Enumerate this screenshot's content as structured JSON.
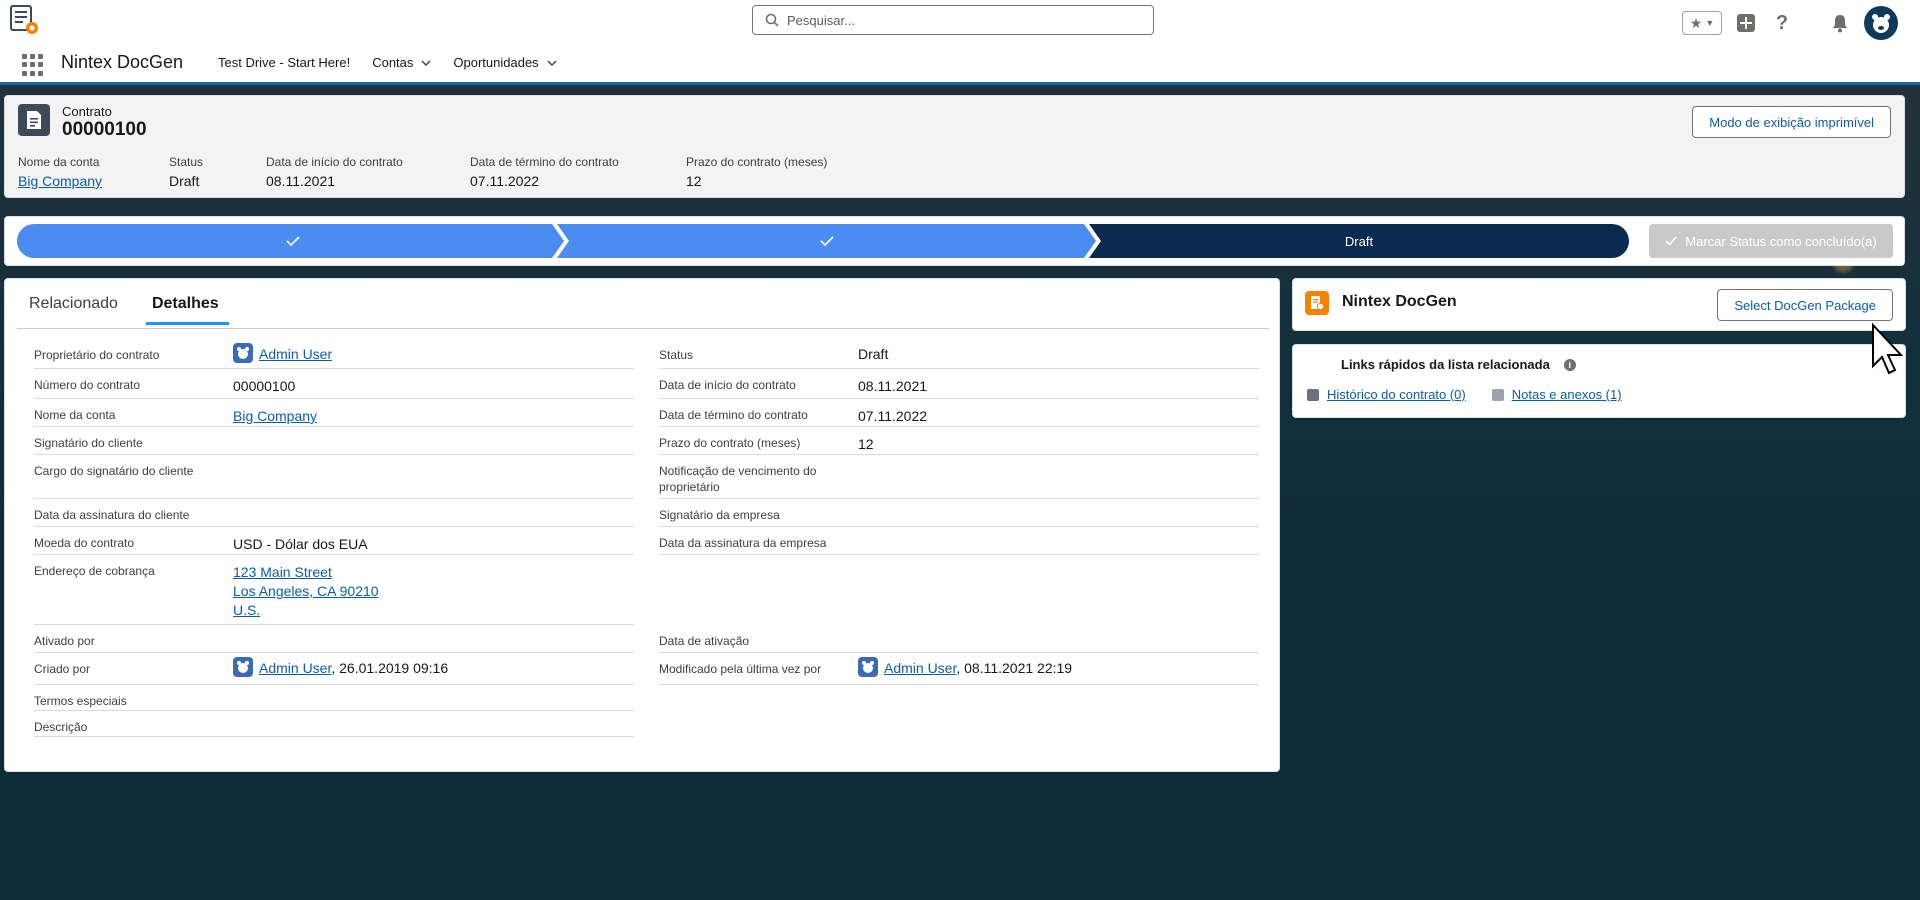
{
  "search": {
    "placeholder": "Pesquisar..."
  },
  "nav": {
    "app_name": "Nintex DocGen",
    "items": [
      {
        "label": "Test Drive - Start Here!",
        "dropdown": false
      },
      {
        "label": "Contas",
        "dropdown": true
      },
      {
        "label": "Oportunidades",
        "dropdown": true
      }
    ]
  },
  "record": {
    "object_type": "Contrato",
    "name": "00000100",
    "printable_label": "Modo de exibição imprimível",
    "highlights": [
      {
        "label": "Nome da conta",
        "value": "Big Company",
        "link": true
      },
      {
        "label": "Status",
        "value": "Draft",
        "link": false
      },
      {
        "label": "Data de início do contrato",
        "value": "08.11.2021",
        "link": false
      },
      {
        "label": "Data de término do contrato",
        "value": "07.11.2022",
        "link": false
      },
      {
        "label": "Prazo do contrato (meses)",
        "value": "12",
        "link": false
      }
    ]
  },
  "path": {
    "stages": [
      {
        "label": "",
        "state": "complete"
      },
      {
        "label": "",
        "state": "complete"
      },
      {
        "label": "Draft",
        "state": "current"
      }
    ],
    "mark_label": "Marcar Status como concluído(a)"
  },
  "tabs": [
    {
      "label": "Relacionado",
      "active": false
    },
    {
      "label": "Detalhes",
      "active": true
    }
  ],
  "details": {
    "left": [
      {
        "label": "Proprietário do contrato",
        "value": "Admin User",
        "type": "user",
        "h": 30
      },
      {
        "label": "Número do contrato",
        "value": "00000100",
        "type": "text",
        "h": 30
      },
      {
        "label": "Nome da conta",
        "value": "Big Company",
        "type": "link",
        "h": 28
      },
      {
        "label": "Signatário do cliente",
        "value": "",
        "type": "text",
        "h": 28
      },
      {
        "label": "Cargo do signatário do cliente",
        "value": "",
        "type": "text",
        "h": 44
      },
      {
        "label": "Data da assinatura do cliente",
        "value": "",
        "type": "text",
        "h": 28
      },
      {
        "label": "Moeda do contrato",
        "value": "USD - Dólar dos EUA",
        "type": "text",
        "h": 28
      },
      {
        "label": "Endereço de cobrança",
        "value": "123 Main Street\nLos Angeles, CA 90210\nU.S.",
        "lines": [
          "123 Main Street",
          "Los Angeles, CA 90210",
          "U.S."
        ],
        "type": "address",
        "h": 70
      },
      {
        "label": "Ativado por",
        "value": "",
        "type": "text",
        "h": 28
      },
      {
        "label": "Criado por",
        "value": "Admin User",
        "extra": ", 26.01.2019 09:16",
        "type": "user",
        "h": 32
      },
      {
        "label": "Termos especiais",
        "value": "",
        "type": "text",
        "h": 26
      },
      {
        "label": "Descrição",
        "value": "",
        "type": "text",
        "h": 26
      }
    ],
    "right": [
      {
        "label": "Status",
        "value": "Draft",
        "type": "text",
        "h": 30
      },
      {
        "label": "Data de início do contrato",
        "value": "08.11.2021",
        "type": "text",
        "h": 30
      },
      {
        "label": "Data de término do contrato",
        "value": "07.11.2022",
        "type": "text",
        "h": 28
      },
      {
        "label": "Prazo do contrato (meses)",
        "value": "12",
        "type": "text",
        "h": 28
      },
      {
        "label": "Notificação de vencimento do proprietário",
        "value": "",
        "type": "text",
        "h": 44
      },
      {
        "label": "Signatário da empresa",
        "value": "",
        "type": "text",
        "h": 28
      },
      {
        "label": "Data da assinatura da empresa",
        "value": "",
        "type": "text",
        "h": 28
      },
      {
        "label": "",
        "value": "",
        "type": "spacer",
        "h": 70,
        "noborder": true
      },
      {
        "label": "Data de ativação",
        "value": "",
        "type": "text",
        "h": 28
      },
      {
        "label": "Modificado pela última vez por",
        "value": "Admin User",
        "extra": ", 08.11.2021 22:19",
        "type": "user",
        "h": 32
      }
    ]
  },
  "docgen": {
    "title": "Nintex DocGen",
    "button_label": "Select DocGen Package"
  },
  "quicklinks": {
    "title": "Links rápidos da lista relacionada",
    "links": [
      {
        "label": "Histórico do contrato (0)",
        "color": "#6b7280"
      },
      {
        "label": "Notas e anexos (1)",
        "color": "#9ca3af"
      }
    ]
  },
  "colors": {
    "path_complete": "#4a8cf0",
    "path_current": "#0b2a4f",
    "brand_blue": "#0b5cab",
    "docgen_orange": "#f38303"
  },
  "icons": [
    "search-icon",
    "favorites-star-icon",
    "add-icon",
    "help-icon",
    "bell-icon",
    "avatar-icon",
    "app-launcher-icon",
    "contract-icon",
    "checkmark-icon",
    "docgen-icon",
    "info-icon",
    "user-icon"
  ]
}
